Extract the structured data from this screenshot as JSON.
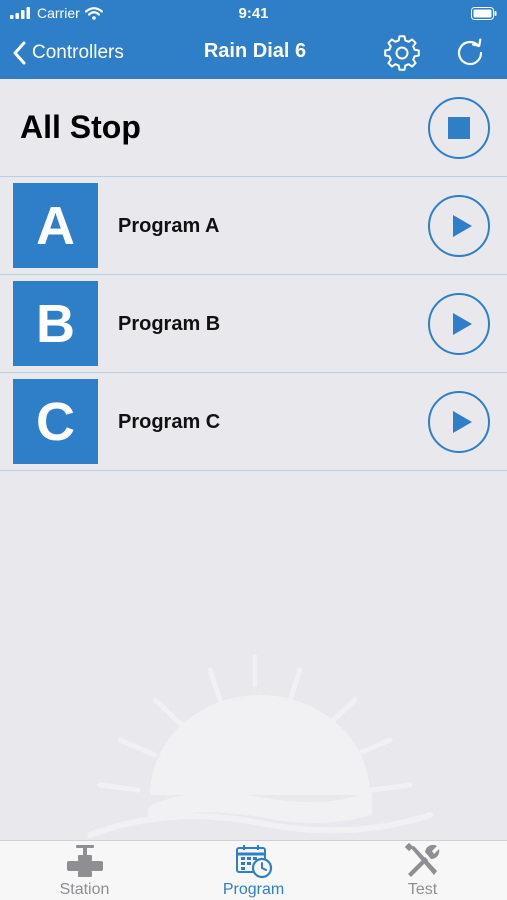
{
  "status_bar": {
    "carrier": "Carrier",
    "time": "9:41"
  },
  "nav": {
    "back_label": "Controllers",
    "title": "Rain Dial 6",
    "settings_icon": "gear-icon",
    "refresh_icon": "refresh-icon"
  },
  "all_stop": {
    "label": "All Stop",
    "button_icon": "stop-icon"
  },
  "programs": [
    {
      "letter": "A",
      "name": "Program A",
      "button_icon": "play-icon"
    },
    {
      "letter": "B",
      "name": "Program B",
      "button_icon": "play-icon"
    },
    {
      "letter": "C",
      "name": "Program C",
      "button_icon": "play-icon"
    }
  ],
  "tabs": [
    {
      "label": "Station",
      "icon": "valve-icon",
      "active": false
    },
    {
      "label": "Program",
      "icon": "calendar-clock-icon",
      "active": true
    },
    {
      "label": "Test",
      "icon": "tools-icon",
      "active": false
    }
  ],
  "colors": {
    "accent": "#2f7fc8",
    "background": "#e8e8ed",
    "tab_inactive": "#8e8e93"
  }
}
